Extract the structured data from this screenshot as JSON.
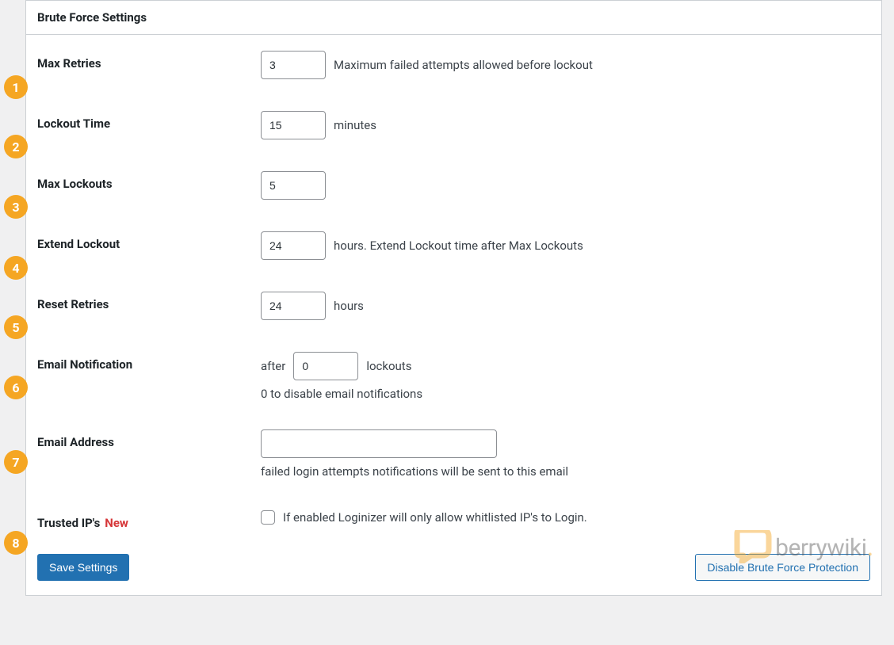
{
  "panel": {
    "title": "Brute Force Settings"
  },
  "badges": [
    "1",
    "2",
    "3",
    "4",
    "5",
    "6",
    "7",
    "8"
  ],
  "rows": {
    "maxRetries": {
      "label": "Max Retries",
      "value": "3",
      "help": "Maximum failed attempts allowed before lockout"
    },
    "lockoutTime": {
      "label": "Lockout Time",
      "value": "15",
      "help": "minutes"
    },
    "maxLockouts": {
      "label": "Max Lockouts",
      "value": "5",
      "help": ""
    },
    "extendLockout": {
      "label": "Extend Lockout",
      "value": "24",
      "help": "hours. Extend Lockout time after Max Lockouts"
    },
    "resetRetries": {
      "label": "Reset Retries",
      "value": "24",
      "help": "hours"
    },
    "emailNotification": {
      "label": "Email Notification",
      "prefix": "after",
      "value": "0",
      "suffix": "lockouts",
      "sub": "0 to disable email notifications"
    },
    "emailAddress": {
      "label": "Email Address",
      "value": "",
      "sub": "failed login attempts notifications will be sent to this email"
    },
    "trustedIps": {
      "label": "Trusted IP's",
      "newTag": "New",
      "help": "If enabled Loginizer will only allow whitlisted IP's to Login."
    }
  },
  "buttons": {
    "save": "Save Settings",
    "disable": "Disable Brute Force Protection"
  },
  "watermark": {
    "text1": "berry",
    "text2": "wiki",
    "dot": "."
  }
}
